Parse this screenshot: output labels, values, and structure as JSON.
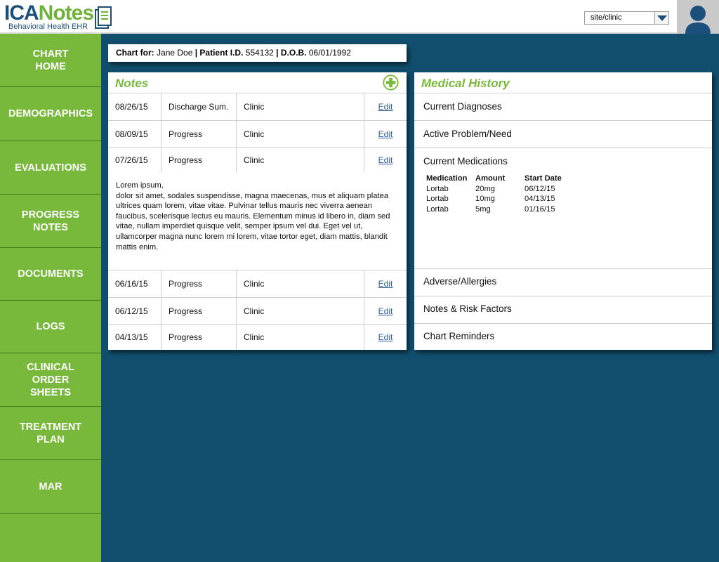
{
  "header": {
    "logo_ica": "ICA",
    "logo_notes": "Notes",
    "logo_subtitle": "Behavioral Health EHR",
    "site_select_value": "site/clinic"
  },
  "sidebar": {
    "items": [
      {
        "label": "CHART\nHOME"
      },
      {
        "label": "DEMOGRAPHICS"
      },
      {
        "label": "EVALUATIONS"
      },
      {
        "label": "PROGRESS\nNOTES"
      },
      {
        "label": "DOCUMENTS"
      },
      {
        "label": "LOGS"
      },
      {
        "label": "CLINICAL\nORDER\nSHEETS"
      },
      {
        "label": "TREATMENT\nPLAN"
      },
      {
        "label": "MAR"
      }
    ]
  },
  "chart_for": {
    "chart_label": "Chart for:",
    "patient_name": "Jane Doe",
    "pid_label": "| Patient I.D.",
    "pid_value": "554132",
    "dob_label": "| D.O.B.",
    "dob_value": "06/01/1992"
  },
  "notes": {
    "title": "Notes",
    "rows": [
      {
        "date": "08/26/15",
        "type": "Discharge Sum.",
        "location": "Clinic",
        "action": "Edit"
      },
      {
        "date": "08/09/15",
        "type": "Progress",
        "location": "Clinic",
        "action": "Edit"
      },
      {
        "date": "07/26/15",
        "type": "Progress",
        "location": "Clinic",
        "action": "Edit"
      },
      {
        "date": "06/16/15",
        "type": "Progress",
        "location": "Clinic",
        "action": "Edit"
      },
      {
        "date": "06/12/15",
        "type": "Progress",
        "location": "Clinic",
        "action": "Edit"
      },
      {
        "date": "04/13/15",
        "type": "Progress",
        "location": "Clinic",
        "action": "Edit"
      }
    ],
    "expanded_text_line1": "Lorem ipsum,",
    "expanded_text_body": "dolor sit amet, sodales suspendisse, magna maecenas, mus et aliquam platea ultrices quam lorem, vitae vitae. Pulvinar tellus mauris nec viverra aenean faucibus, scelerisque lectus eu mauris. Elementum minus id libero in, diam sed vitae, nullam imperdiet quisque velit, semper ipsum vel dui. Eget vel ut, ullamcorper magna nunc lorem mi lorem, vitae tortor eget, diam mattis, blandit mattis enim."
  },
  "medical_history": {
    "title": "Medical History",
    "sections": [
      {
        "label": "Current Diagnoses"
      },
      {
        "label": "Active Problem/Need"
      },
      {
        "label": "Current Medications"
      },
      {
        "label": "Adverse/Allergies"
      },
      {
        "label": "Notes & Risk Factors"
      },
      {
        "label": "Chart Reminders"
      }
    ],
    "medications": {
      "headers": [
        "Medication",
        "Amount",
        "Start Date"
      ],
      "rows": [
        [
          "Lortab",
          "20mg",
          "06/12/15"
        ],
        [
          "Lortab",
          "10mg",
          "04/13/15"
        ],
        [
          "Lortab",
          "5mg",
          "01/16/15"
        ]
      ]
    }
  },
  "colors": {
    "brand_green": "#78b93b",
    "background_blue": "#124f6e",
    "logo_blue": "#1d4f7c",
    "link_blue": "#2f5c9e"
  }
}
